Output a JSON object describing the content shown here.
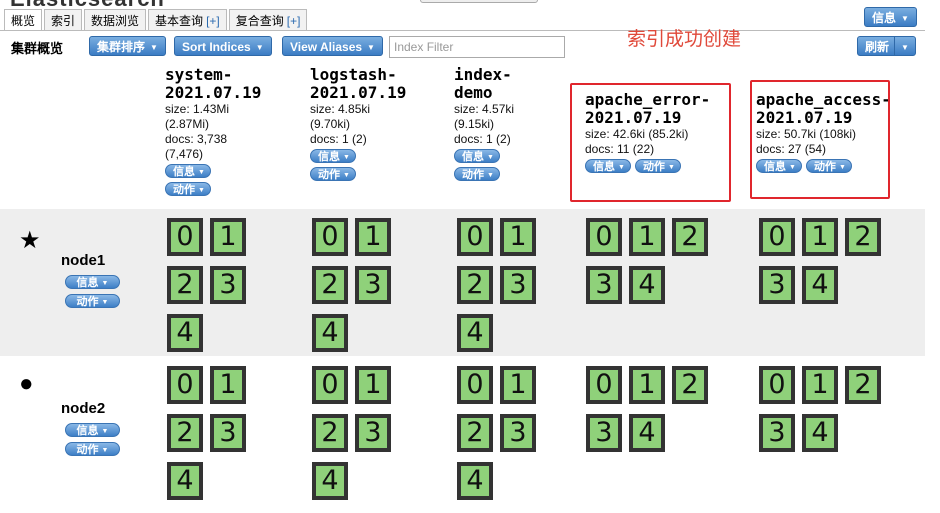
{
  "header": {
    "app_title": "Elasticsearch",
    "info_button": "信息"
  },
  "tabs": [
    {
      "label": "概览",
      "plus": ""
    },
    {
      "label": "索引",
      "plus": ""
    },
    {
      "label": "数据浏览",
      "plus": ""
    },
    {
      "label": "基本查询",
      "plus": "[+]"
    },
    {
      "label": "复合查询",
      "plus": "[+]"
    }
  ],
  "toolbar": {
    "label": "集群概览",
    "sort_cluster": "集群排序",
    "sort_indices": "Sort Indices",
    "view_aliases": "View Aliases",
    "filter_placeholder": "Index Filter",
    "refresh": "刷新"
  },
  "annotation": "索引成功创建",
  "actions": {
    "info": "信息",
    "action": "动作"
  },
  "indices": [
    {
      "name": "system-\n2021.07.19",
      "size": "size: 1.43Mi\n(2.87Mi)",
      "docs": "docs: 3,738\n(7,476)"
    },
    {
      "name": "logstash-\n2021.07.19",
      "size": "size: 4.85ki\n(9.70ki)",
      "docs": "docs: 1 (2)"
    },
    {
      "name": "index-\ndemo",
      "size": "size: 4.57ki\n(9.15ki)",
      "docs": "docs: 1 (2)"
    },
    {
      "name": "apache_error-\n2021.07.19",
      "size": "size: 42.6ki (85.2ki)",
      "docs": "docs: 11 (22)"
    },
    {
      "name": "apache_access-\n2021.07.19",
      "size": "size: 50.7ki (108ki)",
      "docs": "docs: 27 (54)"
    }
  ],
  "nodes": [
    {
      "name": "node1",
      "icon": "★",
      "icon_name": "star-icon"
    },
    {
      "name": "node2",
      "icon": "●",
      "icon_name": "circle-icon"
    }
  ],
  "shards": [
    "0",
    "1",
    "2",
    "3",
    "4"
  ],
  "colors": {
    "accent": "#3b7cc4",
    "shard": "#8fd17a",
    "annotation": "#e0493a",
    "highlight": "#e0262d"
  }
}
